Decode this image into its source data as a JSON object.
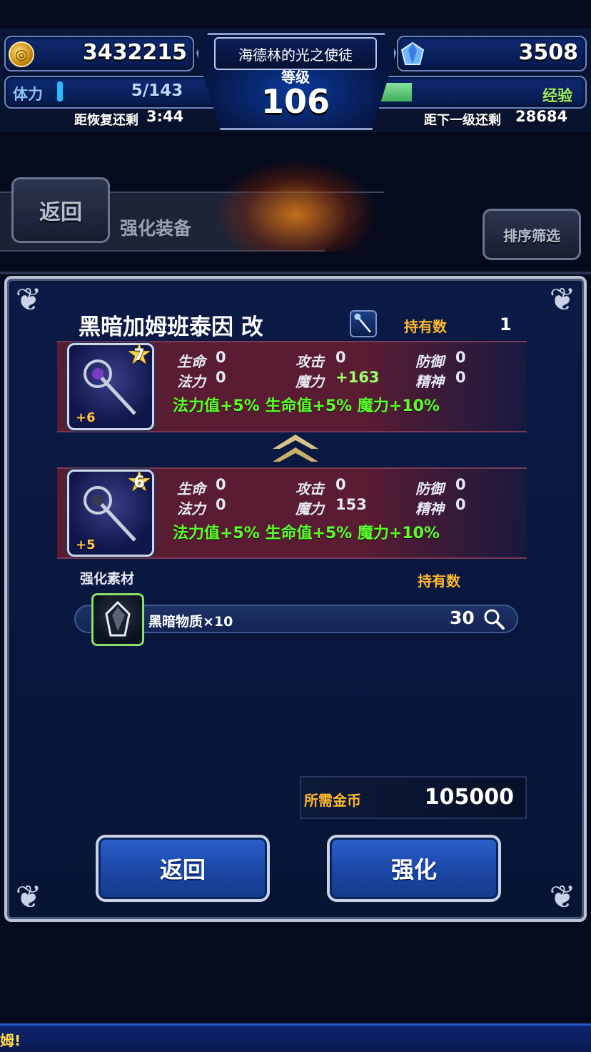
{
  "hud": {
    "gold": "3432215",
    "gems": "3508",
    "player_title": "海德林的光之使徒",
    "level_label": "等级",
    "level": "106",
    "stamina_label": "体力",
    "stamina": "5/143",
    "stamina_recover_label": "距恢复还剩",
    "stamina_recover_time": "3:44",
    "exp_label": "经验",
    "exp_fraction": 0.34,
    "next_level_label": "距下一级还剩",
    "next_level_remaining": "28684"
  },
  "header": {
    "back_label": "返回",
    "title": "强化装备",
    "sort_label": "排序筛选"
  },
  "item": {
    "name": "黑暗加姆班泰因 改",
    "owned_label": "持有数",
    "owned_value": "1"
  },
  "result": {
    "stars": "7",
    "plus": "+6",
    "stats": {
      "hp_label": "生命",
      "hp": "0",
      "atk_label": "攻击",
      "atk": "0",
      "def_label": "防御",
      "def": "0",
      "mp_label": "法力",
      "mp": "0",
      "mag_label": "魔力",
      "mag": "+163",
      "spr_label": "精神",
      "spr": "0"
    },
    "bonus": "法力值+5% 生命值+5% 魔力+10%"
  },
  "current": {
    "stars": "6",
    "plus": "+5",
    "stats": {
      "hp_label": "生命",
      "hp": "0",
      "atk_label": "攻击",
      "atk": "0",
      "def_label": "防御",
      "def": "0",
      "mp_label": "法力",
      "mp": "0",
      "mag_label": "魔力",
      "mag": "153",
      "spr_label": "精神",
      "spr": "0"
    },
    "bonus": "法力值+5% 生命值+5% 魔力+10%"
  },
  "materials": {
    "label": "强化素材",
    "owned_label": "持有数",
    "items": [
      {
        "name": "黑暗物质×10",
        "count": "30"
      }
    ]
  },
  "cost": {
    "label": "所需金币",
    "value": "105000"
  },
  "actions": {
    "back_label": "返回",
    "enhance_label": "强化"
  },
  "ticker": {
    "text": "姆!"
  },
  "colors": {
    "accent_gold": "#ffb830",
    "bonus_green": "#5bff2c",
    "stat_up_green": "#9aff6a",
    "button_blue": "#1c48a8"
  }
}
